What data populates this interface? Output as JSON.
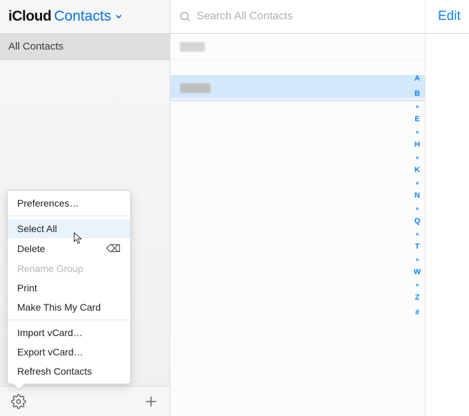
{
  "header": {
    "brand_icloud": "iCloud",
    "brand_contacts": "Contacts"
  },
  "sidebar": {
    "groups": [
      {
        "label": "All Contacts",
        "selected": true
      }
    ]
  },
  "search": {
    "placeholder": "Search All Contacts"
  },
  "alpha_index": [
    "A",
    "B",
    "•",
    "E",
    "•",
    "H",
    "•",
    "K",
    "•",
    "N",
    "•",
    "Q",
    "•",
    "T",
    "•",
    "W",
    "•",
    "Z",
    "#"
  ],
  "detail": {
    "edit_label": "Edit"
  },
  "menu": {
    "items": [
      {
        "label": "Preferences…",
        "type": "item"
      },
      {
        "type": "sep"
      },
      {
        "label": "Select All",
        "type": "item",
        "hovered": true
      },
      {
        "label": "Delete",
        "type": "item",
        "shortcut_icon": "backspace"
      },
      {
        "label": "Rename Group",
        "type": "item",
        "disabled": true
      },
      {
        "label": "Print",
        "type": "item"
      },
      {
        "label": "Make This My Card",
        "type": "item"
      },
      {
        "type": "sep"
      },
      {
        "label": "Import vCard…",
        "type": "item"
      },
      {
        "label": "Export vCard…",
        "type": "item"
      },
      {
        "label": "Refresh Contacts",
        "type": "item"
      }
    ]
  }
}
